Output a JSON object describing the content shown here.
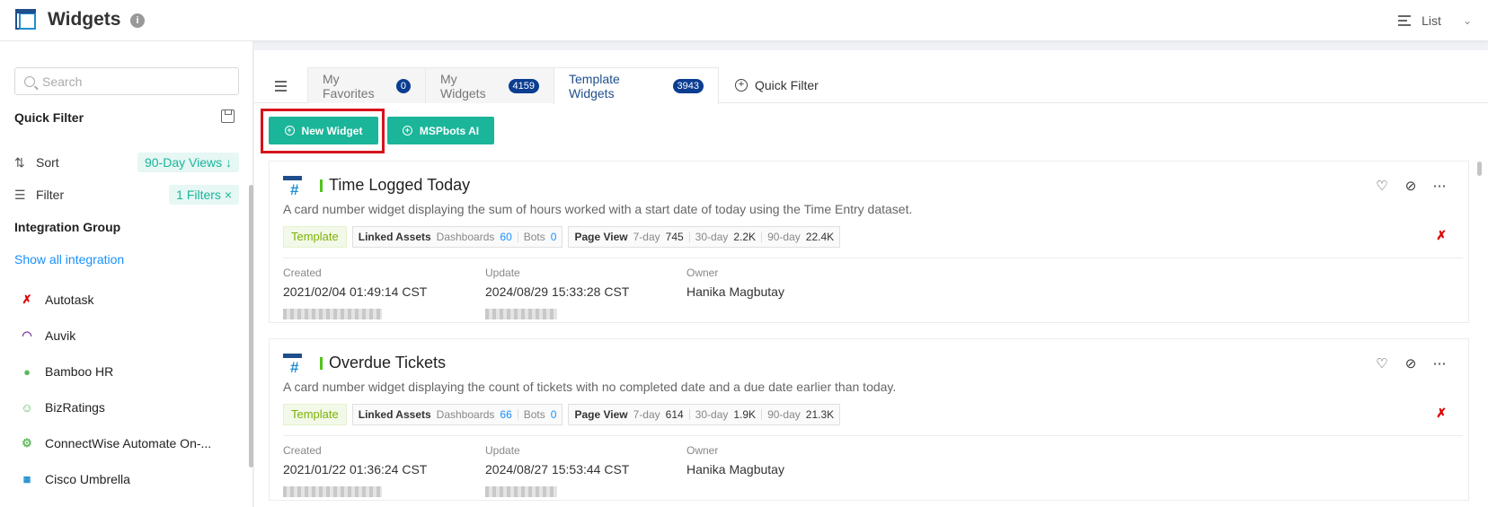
{
  "header": {
    "title": "Widgets",
    "view": "List"
  },
  "sidebar": {
    "search_placeholder": "Search",
    "quick_filter": "Quick Filter",
    "sort_label": "Sort",
    "sort_value": "90-Day Views ↓",
    "filter_label": "Filter",
    "filter_value": "1 Filters ×",
    "integration_group": "Integration Group",
    "show_all": "Show all integration",
    "integrations": [
      {
        "label": "Autotask",
        "icon": "autotask-logo-icon",
        "color": "#d00"
      },
      {
        "label": "Auvik",
        "icon": "auvik-logo-icon",
        "color": "#7b3fa0"
      },
      {
        "label": "Bamboo HR",
        "icon": "bamboohr-logo-icon",
        "color": "#5cb85c"
      },
      {
        "label": "BizRatings",
        "icon": "bizratings-logo-icon",
        "color": "#5cb85c"
      },
      {
        "label": "ConnectWise Automate On-...",
        "icon": "connectwise-logo-icon",
        "color": "#5cb85c"
      },
      {
        "label": "Cisco Umbrella",
        "icon": "cisco-logo-icon",
        "color": "#1f8ed0"
      }
    ]
  },
  "tabs": [
    {
      "label": "My Favorites",
      "count": "0"
    },
    {
      "label": "My Widgets",
      "count": "4159"
    },
    {
      "label": "Template Widgets",
      "count": "3943"
    }
  ],
  "quick_filter_tab": "Quick Filter",
  "buttons": {
    "new_widget": "New Widget",
    "mspbots_ai": "MSPbots AI"
  },
  "labels": {
    "template": "Template",
    "linked_assets": "Linked Assets",
    "dashboards": "Dashboards",
    "bots": "Bots",
    "page_view": "Page View",
    "d7": "7-day",
    "d30": "30-day",
    "d90": "90-day",
    "created": "Created",
    "update": "Update",
    "owner": "Owner"
  },
  "cards": [
    {
      "title": "Time Logged Today",
      "description": "A card number widget displaying the sum of hours worked with a start date of today using the Time Entry dataset.",
      "dashboards": "60",
      "bots": "0",
      "views_7": "745",
      "views_30": "2.2K",
      "views_90": "22.4K",
      "created": "2021/02/04 01:49:14 CST",
      "updated": "2024/08/29 15:33:28 CST",
      "owner": "Hanika Magbutay"
    },
    {
      "title": "Overdue Tickets",
      "description": "A card number widget displaying the count of tickets with no completed date and a due date earlier than today.",
      "dashboards": "66",
      "bots": "0",
      "views_7": "614",
      "views_30": "1.9K",
      "views_90": "21.3K",
      "created": "2021/01/22 01:36:24 CST",
      "updated": "2024/08/27 15:53:44 CST",
      "owner": "Hanika Magbutay"
    }
  ],
  "colors": {
    "accent": "#1bb59a",
    "highlight": "#d6131b",
    "navy": "#0b3d91"
  }
}
